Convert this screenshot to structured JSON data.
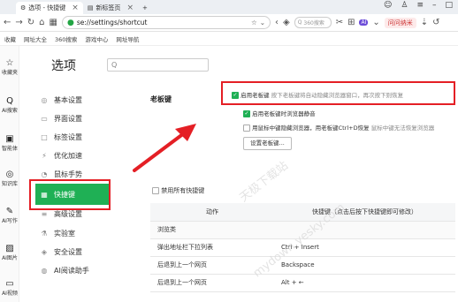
{
  "browser": {
    "tabs": [
      {
        "title": "选项 - 快捷键",
        "active": true
      },
      {
        "title": "新标签页",
        "active": false
      }
    ],
    "new_tab": "+",
    "url": "se://settings/shortcut",
    "search_placeholder": "360搜索",
    "ai_badge": "AI",
    "ask_label": "问问纳米",
    "bookmarks": [
      "收藏",
      "网址大全",
      "360搜索",
      "游戏中心",
      "网址导航"
    ]
  },
  "leftbar": [
    {
      "icon": "☆",
      "label": "收藏夹"
    },
    {
      "icon": "Q",
      "label": "AI搜索"
    },
    {
      "icon": "▣",
      "label": "智能体"
    },
    {
      "icon": "◎",
      "label": "知识库"
    },
    {
      "icon": "✎",
      "label": "AI写作"
    },
    {
      "icon": "▨",
      "label": "AI图片"
    },
    {
      "icon": "▭",
      "label": "AI视频"
    }
  ],
  "settings": {
    "title": "选项",
    "search_icon": "Q",
    "nav": [
      {
        "icon": "◎",
        "label": "基本设置",
        "active": false
      },
      {
        "icon": "▭",
        "label": "界面设置",
        "active": false
      },
      {
        "icon": "□",
        "label": "标签设置",
        "active": false
      },
      {
        "icon": "⚡",
        "label": "优化加速",
        "active": false
      },
      {
        "icon": "◔",
        "label": "鼠标手势",
        "active": false
      },
      {
        "icon": "▦",
        "label": "快捷键",
        "active": true
      },
      {
        "icon": "≡",
        "label": "高级设置",
        "active": false
      },
      {
        "icon": "⚗",
        "label": "实验室",
        "active": false
      },
      {
        "icon": "◈",
        "label": "安全设置",
        "active": false
      },
      {
        "icon": "◍",
        "label": "AI阅读助手",
        "active": false
      }
    ],
    "boss_key": {
      "section_title": "老板键",
      "opt1": "启用老板键",
      "opt1_hint": "按下老板键将自动隐藏浏览器窗口，再次按下则恢复",
      "opt2": "启用老板键时浏览器静音",
      "opt3": "用鼠标中键隐藏浏览器，用老板键Ctrl+D恢复",
      "opt3_hint": "鼠标中键无法恢复浏览器",
      "set_button": "设置老板键..."
    },
    "disable_all": "禁用所有快捷键",
    "table": {
      "col_action": "动作",
      "col_key": "快捷键（点击后按下快捷键即可修改）",
      "category": "浏览类",
      "rows": [
        {
          "action": "弹出地址栏下拉列表",
          "key": "Ctrl + Insert"
        },
        {
          "action": "后退到上一个网页",
          "key": "Backspace"
        },
        {
          "action": "后退到上一个网页",
          "key": "Alt + ←"
        }
      ]
    }
  },
  "watermark": [
    "天极下载站",
    "mydown.yesky.com"
  ],
  "colors": {
    "accent": "#1fb055",
    "highlight": "#e41f25"
  }
}
